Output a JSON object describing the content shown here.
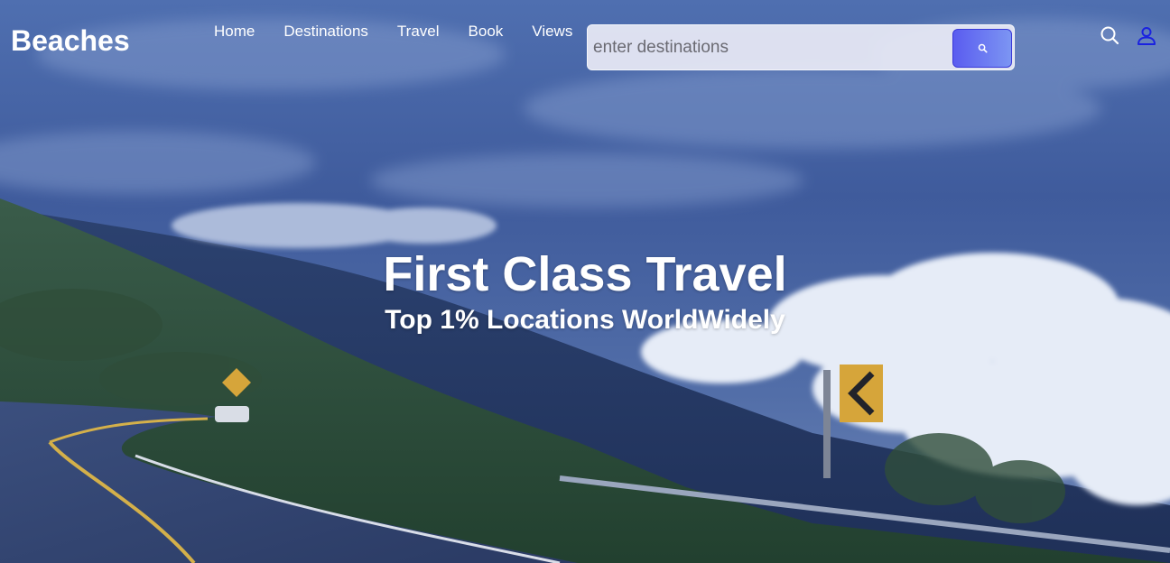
{
  "brand": {
    "name": "Beaches"
  },
  "nav": {
    "items": [
      {
        "label": "Home"
      },
      {
        "label": "Destinations"
      },
      {
        "label": "Travel"
      },
      {
        "label": "Book"
      },
      {
        "label": "Views"
      }
    ]
  },
  "search": {
    "placeholder": "enter destinations",
    "value": ""
  },
  "header_icons": {
    "search": "search-icon",
    "account": "user-icon"
  },
  "hero": {
    "title": "First Class Travel",
    "subtitle": "Top 1% Locations WorldWidely",
    "background": "mountain-road-clouds-photo"
  },
  "colors": {
    "search_button": "#5a5cf0",
    "user_icon": "#1a22e0",
    "text": "#ffffff"
  }
}
